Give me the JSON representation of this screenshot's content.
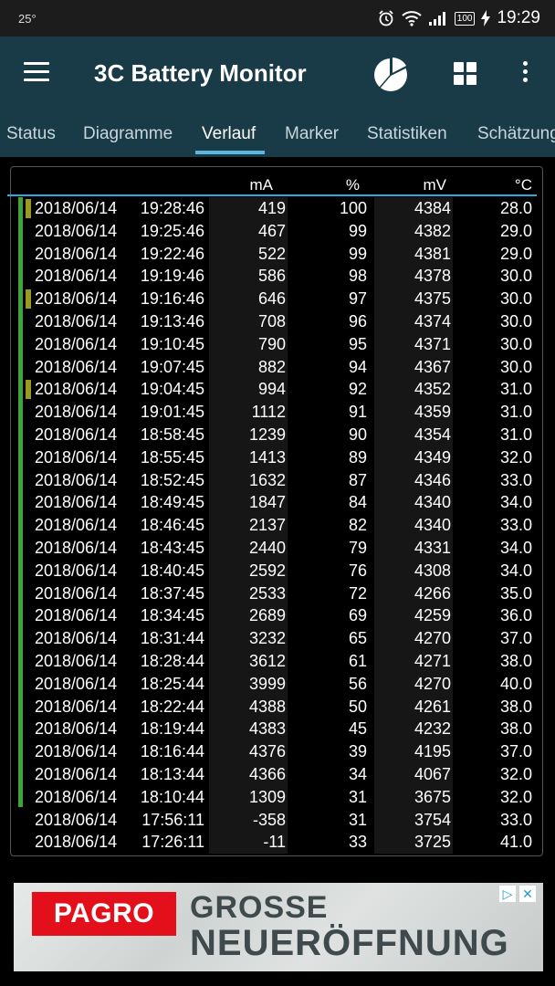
{
  "statusbar": {
    "temperature": "25°",
    "battery": "100",
    "clock": "19:29"
  },
  "appbar": {
    "title": "3C Battery Monitor",
    "icons": [
      "menu-icon",
      "pie-chart-icon",
      "grid-icon",
      "more-vert-icon"
    ]
  },
  "tabs": [
    {
      "label": "Status",
      "active": false
    },
    {
      "label": "Diagramme",
      "active": false
    },
    {
      "label": "Verlauf",
      "active": true
    },
    {
      "label": "Marker",
      "active": false
    },
    {
      "label": "Statistiken",
      "active": false
    },
    {
      "label": "Schätzung",
      "active": false
    }
  ],
  "table": {
    "columns": [
      "mA",
      "%",
      "mV",
      "°C"
    ],
    "rows": [
      {
        "date": "2018/06/14",
        "time": "19:28:46",
        "ma": "419",
        "pct": "100",
        "mv": "4384",
        "temp": "28.0",
        "marker": true
      },
      {
        "date": "2018/06/14",
        "time": "19:25:46",
        "ma": "467",
        "pct": "99",
        "mv": "4382",
        "temp": "29.0",
        "marker": false
      },
      {
        "date": "2018/06/14",
        "time": "19:22:46",
        "ma": "522",
        "pct": "99",
        "mv": "4381",
        "temp": "29.0",
        "marker": false
      },
      {
        "date": "2018/06/14",
        "time": "19:19:46",
        "ma": "586",
        "pct": "98",
        "mv": "4378",
        "temp": "30.0",
        "marker": false
      },
      {
        "date": "2018/06/14",
        "time": "19:16:46",
        "ma": "646",
        "pct": "97",
        "mv": "4375",
        "temp": "30.0",
        "marker": true
      },
      {
        "date": "2018/06/14",
        "time": "19:13:46",
        "ma": "708",
        "pct": "96",
        "mv": "4374",
        "temp": "30.0",
        "marker": false
      },
      {
        "date": "2018/06/14",
        "time": "19:10:45",
        "ma": "790",
        "pct": "95",
        "mv": "4371",
        "temp": "30.0",
        "marker": false
      },
      {
        "date": "2018/06/14",
        "time": "19:07:45",
        "ma": "882",
        "pct": "94",
        "mv": "4367",
        "temp": "30.0",
        "marker": false
      },
      {
        "date": "2018/06/14",
        "time": "19:04:45",
        "ma": "994",
        "pct": "92",
        "mv": "4352",
        "temp": "31.0",
        "marker": true
      },
      {
        "date": "2018/06/14",
        "time": "19:01:45",
        "ma": "1112",
        "pct": "91",
        "mv": "4359",
        "temp": "31.0",
        "marker": false
      },
      {
        "date": "2018/06/14",
        "time": "18:58:45",
        "ma": "1239",
        "pct": "90",
        "mv": "4354",
        "temp": "31.0",
        "marker": false
      },
      {
        "date": "2018/06/14",
        "time": "18:55:45",
        "ma": "1413",
        "pct": "89",
        "mv": "4349",
        "temp": "32.0",
        "marker": false
      },
      {
        "date": "2018/06/14",
        "time": "18:52:45",
        "ma": "1632",
        "pct": "87",
        "mv": "4346",
        "temp": "33.0",
        "marker": false
      },
      {
        "date": "2018/06/14",
        "time": "18:49:45",
        "ma": "1847",
        "pct": "84",
        "mv": "4340",
        "temp": "34.0",
        "marker": false
      },
      {
        "date": "2018/06/14",
        "time": "18:46:45",
        "ma": "2137",
        "pct": "82",
        "mv": "4340",
        "temp": "33.0",
        "marker": false
      },
      {
        "date": "2018/06/14",
        "time": "18:43:45",
        "ma": "2440",
        "pct": "79",
        "mv": "4331",
        "temp": "34.0",
        "marker": false
      },
      {
        "date": "2018/06/14",
        "time": "18:40:45",
        "ma": "2592",
        "pct": "76",
        "mv": "4308",
        "temp": "34.0",
        "marker": false
      },
      {
        "date": "2018/06/14",
        "time": "18:37:45",
        "ma": "2533",
        "pct": "72",
        "mv": "4266",
        "temp": "35.0",
        "marker": false
      },
      {
        "date": "2018/06/14",
        "time": "18:34:45",
        "ma": "2689",
        "pct": "69",
        "mv": "4259",
        "temp": "36.0",
        "marker": false
      },
      {
        "date": "2018/06/14",
        "time": "18:31:44",
        "ma": "3232",
        "pct": "65",
        "mv": "4270",
        "temp": "37.0",
        "marker": false
      },
      {
        "date": "2018/06/14",
        "time": "18:28:44",
        "ma": "3612",
        "pct": "61",
        "mv": "4271",
        "temp": "38.0",
        "marker": false
      },
      {
        "date": "2018/06/14",
        "time": "18:25:44",
        "ma": "3999",
        "pct": "56",
        "mv": "4270",
        "temp": "40.0",
        "marker": false
      },
      {
        "date": "2018/06/14",
        "time": "18:22:44",
        "ma": "4388",
        "pct": "50",
        "mv": "4261",
        "temp": "38.0",
        "marker": false
      },
      {
        "date": "2018/06/14",
        "time": "18:19:44",
        "ma": "4383",
        "pct": "45",
        "mv": "4232",
        "temp": "38.0",
        "marker": false
      },
      {
        "date": "2018/06/14",
        "time": "18:16:44",
        "ma": "4376",
        "pct": "39",
        "mv": "4195",
        "temp": "37.0",
        "marker": false
      },
      {
        "date": "2018/06/14",
        "time": "18:13:44",
        "ma": "4366",
        "pct": "34",
        "mv": "4067",
        "temp": "32.0",
        "marker": false
      },
      {
        "date": "2018/06/14",
        "time": "18:10:44",
        "ma": "1309",
        "pct": "31",
        "mv": "3675",
        "temp": "32.0",
        "marker": false
      },
      {
        "date": "2018/06/14",
        "time": "17:56:11",
        "ma": "-358",
        "pct": "31",
        "mv": "3754",
        "temp": "33.0",
        "marker": false
      },
      {
        "date": "2018/06/14",
        "time": "17:26:11",
        "ma": "-11",
        "pct": "33",
        "mv": "3725",
        "temp": "41.0",
        "marker": false
      }
    ],
    "charging_rows": 27
  },
  "ad": {
    "logo": "PAGRO",
    "line1": "GROSSE",
    "line2": "NEUERÖFFNUNG"
  },
  "colors": {
    "appbar": "#193a47",
    "accent": "#5fb6de",
    "charging": "#3ea33a",
    "marker": "#9a9a22"
  }
}
